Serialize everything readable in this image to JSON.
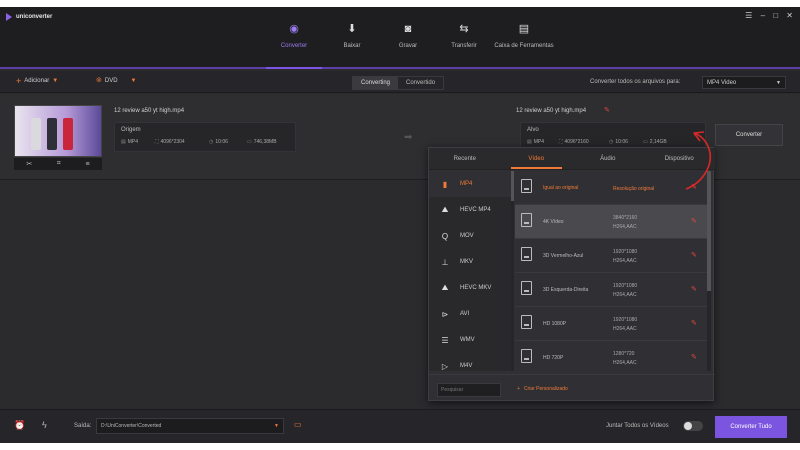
{
  "app": {
    "name": "uniconverter",
    "window_controls": "☰ – □ ✕"
  },
  "nav": [
    {
      "label": "Converter",
      "icon": "convert-icon"
    },
    {
      "label": "Baixar",
      "icon": "download-icon"
    },
    {
      "label": "Gravar",
      "icon": "burn-icon"
    },
    {
      "label": "Transferir",
      "icon": "transfer-icon"
    },
    {
      "label": "Caixa de Ferramentas",
      "icon": "toolbox-icon"
    }
  ],
  "toolbar": {
    "add_label": "Adicionar",
    "dvd_label": "DVD",
    "tabs": [
      "Converting",
      "Convertido"
    ],
    "convert_all_label": "Converter todos os arquivos para:",
    "convert_all_value": "MP4 Video"
  },
  "file": {
    "source_name": "12 review a50 yt high.mp4",
    "source_label": "Origem",
    "source_meta": {
      "format": "MP4",
      "resolution": "4096*2304",
      "duration": "10:06",
      "size": "746,38MB"
    },
    "target_name": "12 review a50 yt high.mp4",
    "target_label": "Alvo",
    "target_meta": {
      "format": "MP4",
      "resolution": "4096*2160",
      "duration": "10:06",
      "size": "2,14GB"
    },
    "convert_label": "Converter"
  },
  "popup": {
    "tabs": [
      "Recente",
      "Vídeo",
      "Áudio",
      "Dispositivo"
    ],
    "formats": [
      "MP4",
      "HEVC MP4",
      "MOV",
      "MKV",
      "HEVC MKV",
      "AVI",
      "WMV",
      "M4V"
    ],
    "resolutions": [
      {
        "name": "Igual ao original",
        "spec1": "Resolução original",
        "spec2": ""
      },
      {
        "name": "4K Vídeo",
        "spec1": "3840*2160",
        "spec2": "H264,AAC"
      },
      {
        "name": "3D Vermelho-Azul",
        "spec1": "1920*1080",
        "spec2": "H264,AAC"
      },
      {
        "name": "3D Esquerda-Direita",
        "spec1": "1920*1080",
        "spec2": "H264,AAC"
      },
      {
        "name": "HD 1080P",
        "spec1": "1920*1080",
        "spec2": "H264,AAC"
      },
      {
        "name": "HD 720P",
        "spec1": "1280*720",
        "spec2": "H264,AAC"
      }
    ],
    "search_placeholder": "Pesquisar",
    "custom_label": "Criar Personalizado"
  },
  "bottom": {
    "output_label": "Saída:",
    "output_path": "D:\\UniConverter\\Converted",
    "merge_label": "Juntar Todos os Vídeos",
    "convert_all_button": "Converter Tudo"
  },
  "colors": {
    "accent": "#7b55e0",
    "orange": "#f07a3a",
    "red": "#e8453c"
  }
}
